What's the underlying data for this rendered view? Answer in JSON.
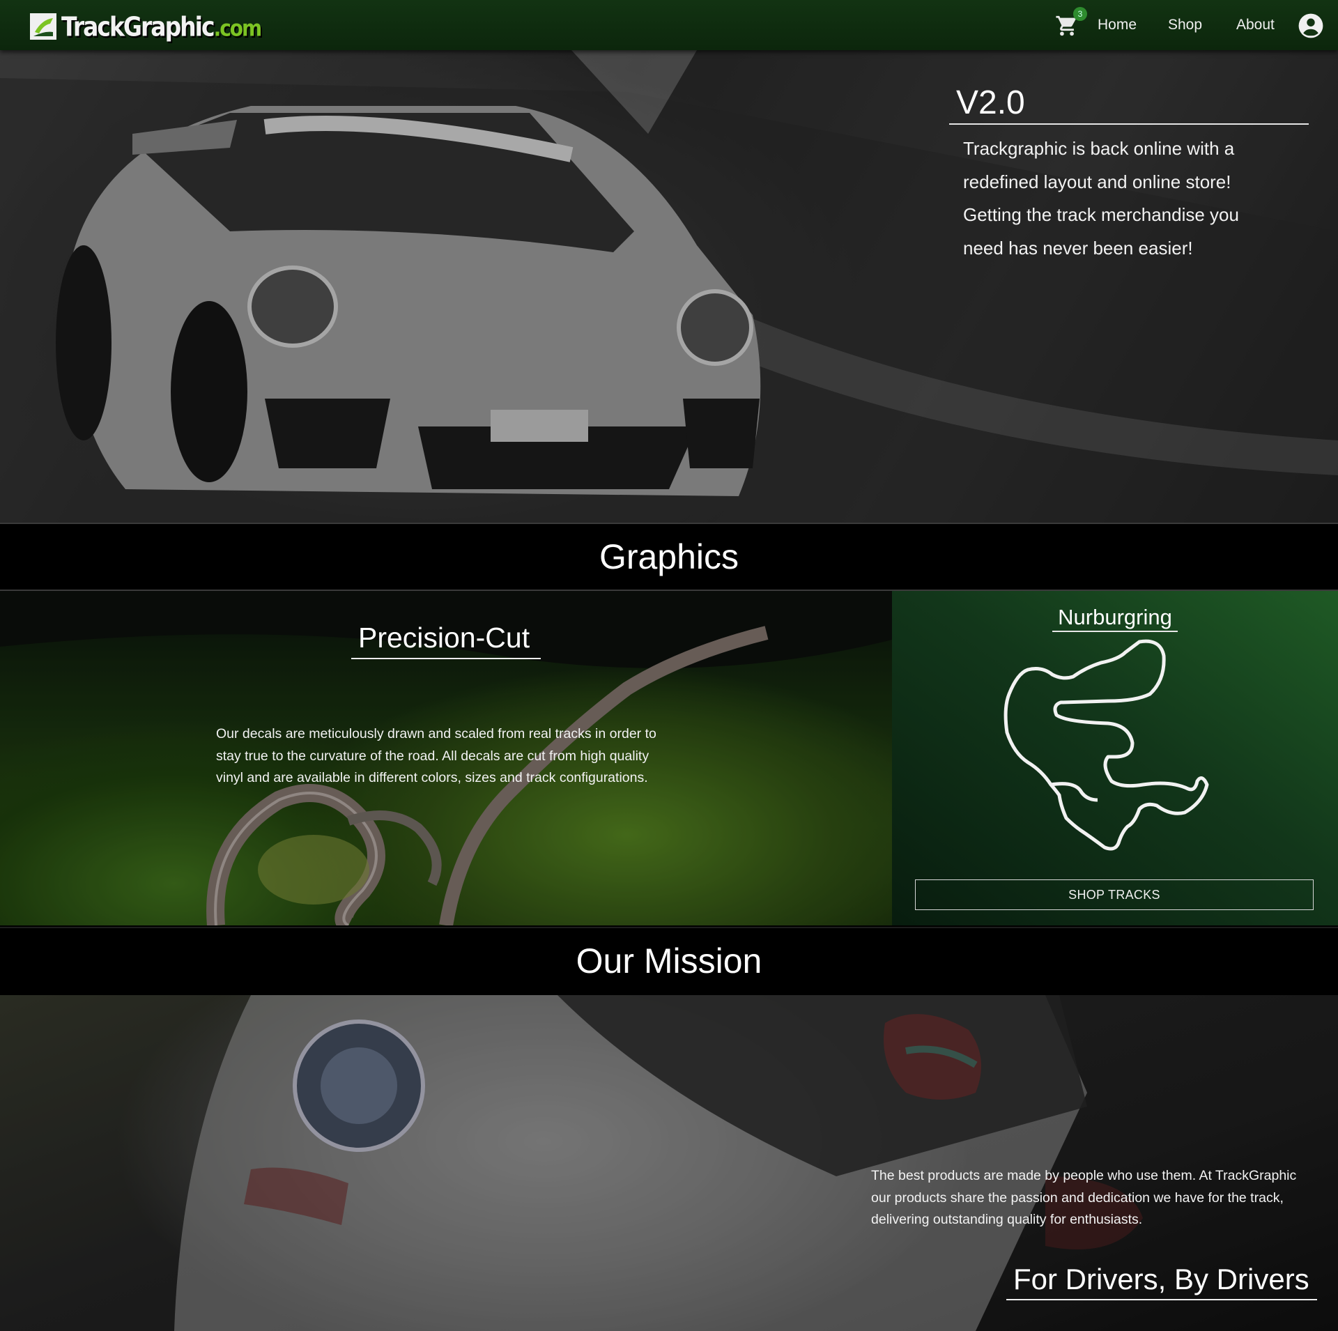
{
  "nav": {
    "logo_text": "TrackGraphic",
    "logo_suffix": ".com",
    "cart_count": "3",
    "links": [
      "Home",
      "Shop",
      "About"
    ],
    "icons": [
      "cart-icon",
      "account-icon"
    ]
  },
  "hero": {
    "title": "V2.0",
    "text": "Trackgraphic is back online with a redefined layout and online store! Getting the track merchandise you need has never been easier!"
  },
  "graphics": {
    "heading": "Graphics",
    "precision_title": "Precision-Cut",
    "precision_text": "Our decals are meticulously drawn and scaled from real tracks in order to stay true to the curvature of the road. All decals are cut from high quality vinyl and are available in different colors, sizes and track configurations.",
    "track_name": "Nurburgring",
    "shop_button": "SHOP TRACKS"
  },
  "mission": {
    "heading": "Our Mission",
    "text": "The best products are made by people who use them. At TrackGraphic our products share the passion and dedication we have for the track, delivering outstanding quality for enthusiasts.",
    "tagline": "For Drivers, By Drivers"
  },
  "colors": {
    "nav_bg": "#123312",
    "accent_green": "#7cc423",
    "badge_green": "#2e8b2e",
    "track_panel": "#12361a"
  }
}
